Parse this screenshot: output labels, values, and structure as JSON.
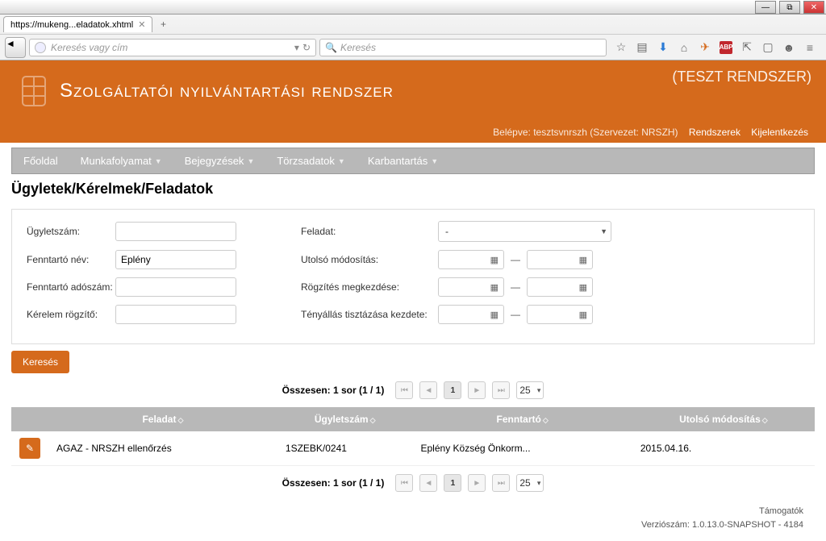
{
  "browser": {
    "tab_title": "https://mukeng...eladatok.xhtml",
    "url_placeholder": "Keresés vagy cím",
    "search_placeholder": "Keresés"
  },
  "header": {
    "app_title": "Szolgáltatói nyilvántartási rendszer",
    "test_badge": "(TESZT RENDSZER)",
    "login_prefix": "Belépve:",
    "login_user": "tesztsvnrszh (Szervezet: NRSZH)",
    "link_systems": "Rendszerek",
    "link_logout": "Kijelentkezés"
  },
  "menu": {
    "home": "Főoldal",
    "workflow": "Munkafolyamat",
    "entries": "Bejegyzések",
    "masterdata": "Törzsadatok",
    "maintenance": "Karbantartás"
  },
  "page_heading": "Ügyletek/Kérelmek/Feladatok",
  "filters": {
    "ugyletszam_label": "Ügyletszám:",
    "ugyletszam_value": "",
    "feladat_label": "Feladat:",
    "feladat_value": "-",
    "fenntarto_nev_label": "Fenntartó név:",
    "fenntarto_nev_value": "Eplény",
    "utolso_mod_label": "Utolsó módosítás:",
    "fenntarto_ado_label": "Fenntartó adószám:",
    "fenntarto_ado_value": "",
    "rogzites_label": "Rögzítés megkezdése:",
    "kerelem_rogz_label": "Kérelem rögzítő:",
    "kerelem_rogz_value": "",
    "tenyallas_label": "Tényállás tisztázása kezdete:",
    "search_btn": "Keresés"
  },
  "pager": {
    "summary": "Összesen: 1 sor (1 / 1)",
    "current_page": "1",
    "page_size": "25"
  },
  "table": {
    "col_feladat": "Feladat",
    "col_ugyletszam": "Ügyletszám",
    "col_fenntarto": "Fenntartó",
    "col_utolso": "Utolsó módosítás",
    "rows": [
      {
        "feladat": "AGAZ - NRSZH ellenőrzés",
        "ugyletszam": "1SZEBK/0241",
        "fenntarto": "Eplény Község Önkorm...",
        "utolso": "2015.04.16."
      }
    ]
  },
  "footer": {
    "sponsors": "Támogatók",
    "version_label": "Verziószám:",
    "version": "1.0.13.0-SNAPSHOT - 4184"
  }
}
